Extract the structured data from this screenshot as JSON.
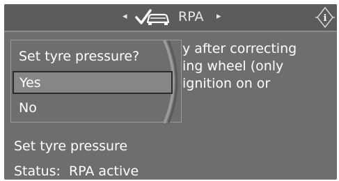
{
  "header": {
    "title": "RPA",
    "left_arrow": "◂",
    "right_arrow": "▸",
    "icon": "rpa-check-car-icon",
    "info_icon": "info-icon",
    "info_label": "i"
  },
  "background_text": {
    "lines": [
      "y after correcting",
      "ing wheel (only",
      "ignition on or"
    ]
  },
  "dialog": {
    "title": "Set tyre pressure?",
    "options": [
      {
        "label": "Yes",
        "selected": true
      },
      {
        "label": "No",
        "selected": false
      }
    ]
  },
  "footer": {
    "action": "Set tyre pressure",
    "status_label": "Status:",
    "status_value": "RPA active"
  },
  "colors": {
    "screen_bg": "#6e6e6e",
    "text": "#ffffff",
    "selection_border": "#2a2a2a"
  }
}
